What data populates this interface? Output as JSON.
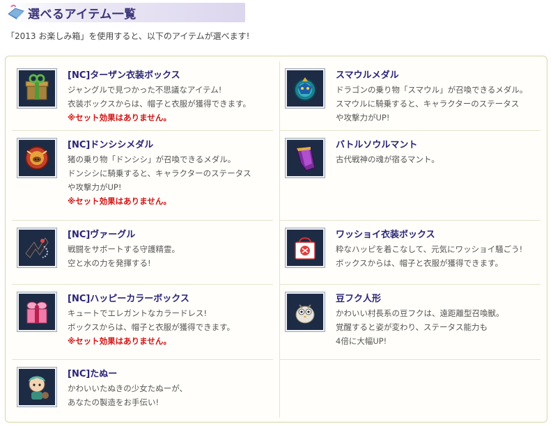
{
  "header": {
    "title": "選べるアイテム一覧"
  },
  "intro": "「2013 お楽しみ箱」を使用すると、以下のアイテムが選べます!",
  "items": [
    {
      "name": "[NC]ターザン衣装ボックス",
      "icon": "gift-box-icon",
      "desc": [
        "ジャングルで見つかった不思議なアイテム!",
        "衣装ボックスからは、帽子と衣服が獲得できます。"
      ],
      "note": "※セット効果はありません。"
    },
    {
      "name": "スマウルメダル",
      "icon": "dragon-medal-icon",
      "desc": [
        "ドラゴンの乗り物「スマウル」が召喚できるメダル。",
        "スマウルに騎乗すると、キャラクターのステータス",
        "や攻撃力がUP!"
      ],
      "note": ""
    },
    {
      "name": "[NC]ドンシシメダル",
      "icon": "boar-medal-icon",
      "desc": [
        "猪の乗り物「ドンシシ」が召喚できるメダル。",
        "ドンシシに騎乗すると、キャラクターのステータス",
        "や攻撃力がUP!"
      ],
      "note": "※セット効果はありません。"
    },
    {
      "name": "バトルソウルマント",
      "icon": "cape-icon",
      "desc": [
        "古代戦神の魂が宿るマント。"
      ],
      "note": ""
    },
    {
      "name": "[NC]ヴァーグル",
      "icon": "spirit-icon",
      "desc": [
        "戦闘をサポートする守護精霊。",
        "空と水の力を発揮する!"
      ],
      "note": ""
    },
    {
      "name": "ワッショイ衣装ボックス",
      "icon": "festival-bag-icon",
      "desc": [
        "粋なハッピを着こなして、元気にワッショイ騒ごう!",
        "ボックスからは、帽子と衣服が獲得できます。"
      ],
      "note": ""
    },
    {
      "name": "[NC]ハッピーカラーボックス",
      "icon": "ribbon-box-icon",
      "desc": [
        "キュートでエレガントなカラードレス!",
        "ボックスからは、帽子と衣服が獲得できます。"
      ],
      "note": "※セット効果はありません。"
    },
    {
      "name": "豆フク人形",
      "icon": "owl-doll-icon",
      "desc": [
        "かわいい村長系の豆フクは、遠距離型召喚獣。",
        "覚醒すると姿が変わり、ステータス能力も",
        "4倍に大幅UP!"
      ],
      "note": ""
    },
    {
      "name": "[NC]たぬー",
      "icon": "tanuki-girl-icon",
      "desc": [
        "かわいいたぬきの少女たぬーが、",
        "あなたの製造をお手伝い!"
      ],
      "note": ""
    }
  ]
}
